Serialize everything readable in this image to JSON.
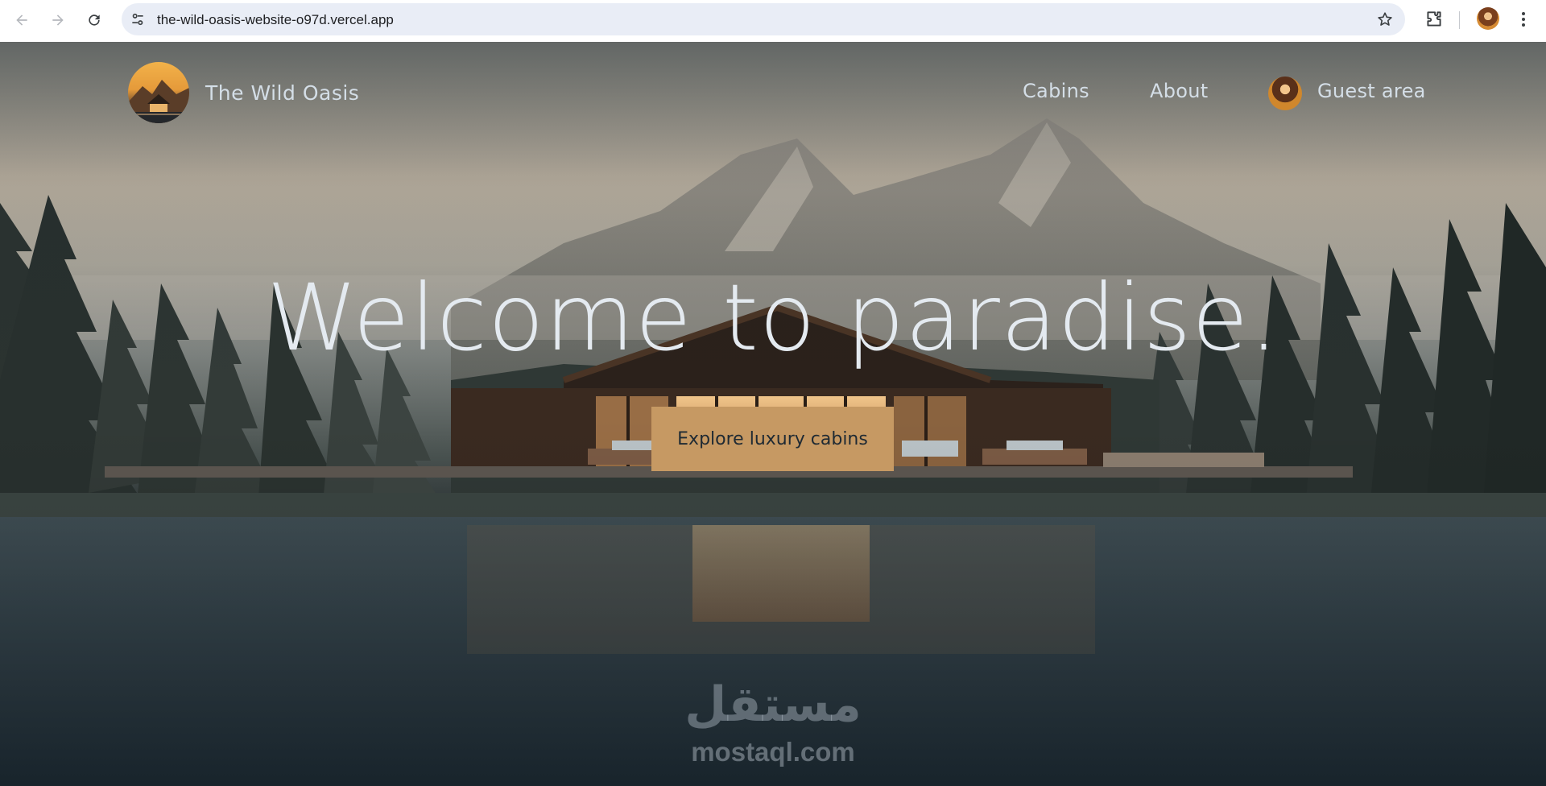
{
  "browser": {
    "url": "the-wild-oasis-website-o97d.vercel.app",
    "icons": {
      "back": "arrow-back-icon",
      "forward": "arrow-forward-icon",
      "reload": "reload-icon",
      "site_info": "tune-icon",
      "bookmark": "star-icon",
      "extensions": "puzzle-icon",
      "menu": "kebab-menu-icon"
    }
  },
  "header": {
    "brand": "The Wild Oasis",
    "nav": [
      {
        "label": "Cabins"
      },
      {
        "label": "About"
      },
      {
        "label": "Guest area"
      }
    ]
  },
  "hero": {
    "headline": "Welcome to paradise.",
    "cta_label": "Explore luxury cabins"
  },
  "watermark": {
    "arabic": "مستقل",
    "latin": "mostaql.com"
  },
  "colors": {
    "cta": "#c69963",
    "text_light": "#d4dee7",
    "headline": "#e4eaf0",
    "omnibox": "#e9edf6"
  }
}
